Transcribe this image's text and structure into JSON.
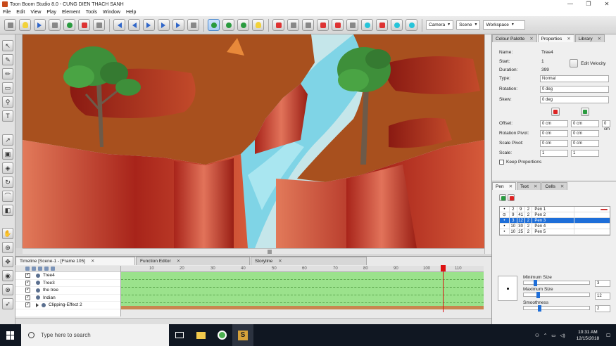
{
  "window": {
    "title": "Toon Boom Studio 8.0 - CUNG DIEN THACH SANH",
    "controls": [
      "—",
      "❐",
      "✕"
    ]
  },
  "menu": [
    "File",
    "Edit",
    "View",
    "Play",
    "Element",
    "Tools",
    "Window",
    "Help"
  ],
  "toolbar": {
    "camera_label": "Camera",
    "scene_label": "Scene",
    "workspace_label": "Workspace"
  },
  "timeline": {
    "tabs": [
      {
        "label": "Timeline [Scene-1 - [Frame 105]",
        "active": true
      },
      {
        "label": "Function Editor",
        "active": false
      },
      {
        "label": "Storyline",
        "active": false
      }
    ],
    "ruler_ticks": [
      "10",
      "20",
      "30",
      "40",
      "50",
      "60",
      "70",
      "80",
      "90",
      "100",
      "110"
    ],
    "current_frame": 105,
    "layers": [
      {
        "name": "Tree4",
        "checked": true
      },
      {
        "name": "Tree3",
        "checked": true
      },
      {
        "name": "the tree",
        "checked": true
      },
      {
        "name": "Indian",
        "checked": true
      },
      {
        "name": "Clipping-Effect 2",
        "checked": true
      }
    ]
  },
  "right_panel": {
    "tabs": [
      {
        "label": "Colour Palette",
        "active": false
      },
      {
        "label": "Properties",
        "active": true
      },
      {
        "label": "Library",
        "active": false
      }
    ],
    "properties": {
      "name_label": "Name:",
      "name_value": "Tree4",
      "start_label": "Start:",
      "start_value": "1",
      "duration_label": "Duration:",
      "duration_value": "399",
      "type_label": "Type:",
      "type_value": "Normal",
      "rotation_label": "Rotation:",
      "rotation_value": "0 deg",
      "skew_label": "Skew:",
      "skew_value": "0 deg",
      "edit_velocity_label": "Edit Velocity",
      "offset_label": "Offset:",
      "rotation_pivot_label": "Rotation Pivot:",
      "scale_pivot_label": "Scale Pivot:",
      "scale_label": "Scale:",
      "cm_value": "0 cm",
      "scale_value": "1",
      "keep_proportions_label": "Keep Proportions"
    },
    "pen_tabs": [
      {
        "label": "Pen",
        "active": true
      },
      {
        "label": "Text",
        "active": false
      },
      {
        "label": "Cells",
        "active": false
      }
    ],
    "pens": [
      {
        "c0": "•",
        "c1": "2",
        "c2": "9",
        "c3": "2",
        "name": "Pen 1",
        "selected": false,
        "stroke": true
      },
      {
        "c0": "⊙",
        "c1": "9",
        "c2": "41",
        "c3": "2",
        "name": "Pen 2",
        "selected": false,
        "stroke": false
      },
      {
        "c0": "•",
        "c1": "3",
        "c2": "12",
        "c3": "2",
        "name": "Pen 3",
        "selected": true,
        "stroke": false
      },
      {
        "c0": "•",
        "c1": "10",
        "c2": "30",
        "c3": "2",
        "name": "Pen 4",
        "selected": false,
        "stroke": false
      },
      {
        "c0": "•",
        "c1": "10",
        "c2": "25",
        "c3": "2",
        "name": "Pen 5",
        "selected": false,
        "stroke": false
      }
    ],
    "minimum_size_label": "Minimum Size",
    "minimum_size_value": "3",
    "maximum_size_label": "Maximum Size",
    "maximum_size_value": "12",
    "smoothness_label": "Smoothness",
    "smoothness_value": "2"
  },
  "taskbar": {
    "search_placeholder": "Type here to search",
    "time": "10:31 AM",
    "date": "12/15/2018"
  },
  "colors": {
    "sky": "#c5e6ea",
    "cliff_top": "#a8501e",
    "cliff_face": "#b02a1a",
    "tree_green": "#3e8f3a",
    "timeline_green": "#9be28c",
    "selected_blue": "#1e6ed8"
  }
}
